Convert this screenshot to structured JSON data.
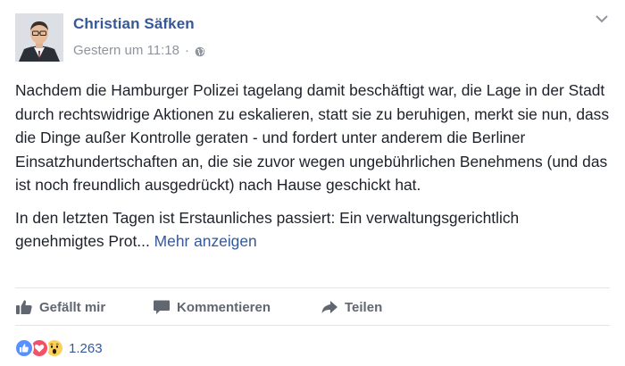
{
  "author": {
    "name": "Christian Säfken",
    "avatar_icon": "profile-photo"
  },
  "meta": {
    "timestamp": "Gestern um 11:18",
    "separator": "·",
    "audience_icon": "globe-icon"
  },
  "post": {
    "paragraph1": "Nachdem die Hamburger Polizei tagelang damit beschäftigt war, die Lage in der Stadt durch rechtswidrige Aktionen zu eskalieren, statt sie zu beruhigen, merkt sie nun, dass die Dinge außer Kontrolle geraten - und fordert unter anderem die Berliner Einsatzhundertschaften an, die sie zuvor wegen ungebührlichen Benehmens (und das ist noch freundlich ausgedrückt) nach Hause geschickt hat.",
    "paragraph2": "In den letzten Tagen ist Erstaunliches passiert: Ein verwaltungsgerichtlich genehmigtes Prot...",
    "see_more": "Mehr anzeigen"
  },
  "actions": {
    "like": "Gefällt mir",
    "comment": "Kommentieren",
    "share": "Teilen"
  },
  "reactions": {
    "types": [
      "like",
      "love",
      "wow"
    ],
    "count": "1.263"
  },
  "colors": {
    "link": "#365899",
    "text": "#1d2129",
    "muted": "#90949c",
    "action": "#616770",
    "like_blue": "#5890ff",
    "love_red": "#f25268",
    "wow_yellow": "#fcd15b"
  }
}
